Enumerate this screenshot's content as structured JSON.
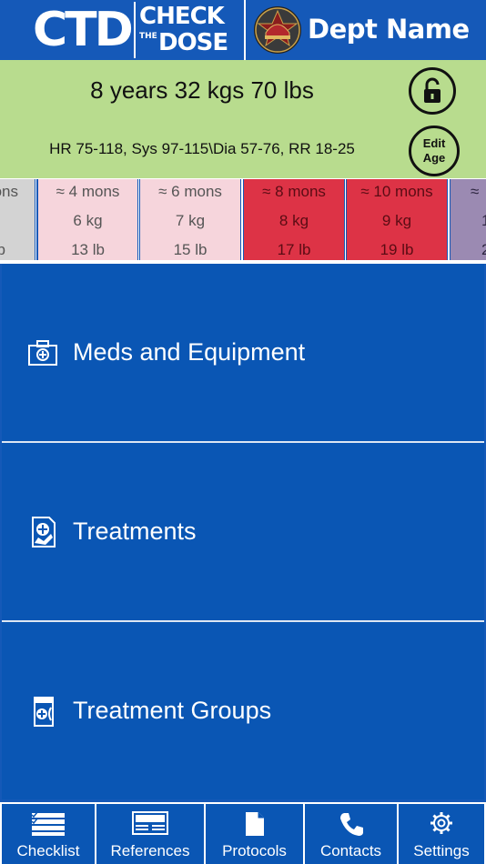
{
  "header": {
    "logo_ctd": "CTD",
    "logo_check": "CHECK",
    "logo_the": "THE",
    "logo_dose": "DOSE",
    "dept_name": "Dept Name",
    "dept_logo_icon": "fire-dept-badge-icon"
  },
  "patient": {
    "weight_line": "8 years 32 kgs 70 lbs",
    "vitals_line": "HR 75-118, Sys 97-115\\Dia 57-76, RR 18-25",
    "edit_label_1": "Edit",
    "edit_label_2": "Age",
    "lock_icon": "unlock-icon",
    "background_color": "#b8dc8e"
  },
  "age_strip": {
    "cells": [
      {
        "age": "ons",
        "kg": "",
        "lb": "b",
        "color": "#d3d3d3",
        "text_color": "#555555"
      },
      {
        "age": "≈ 4 mons",
        "kg": "6 kg",
        "lb": "13 lb",
        "color": "#f6d5dc",
        "text_color": "#555555"
      },
      {
        "age": "≈ 6 mons",
        "kg": "7 kg",
        "lb": "15 lb",
        "color": "#f6d5dc",
        "text_color": "#555555"
      },
      {
        "age": "≈ 8 mons",
        "kg": "8 kg",
        "lb": "17 lb",
        "color": "#dd3346",
        "text_color": "#5a0c14"
      },
      {
        "age": "≈ 10 mons",
        "kg": "9 kg",
        "lb": "19 lb",
        "color": "#dd3346",
        "text_color": "#5a0c14"
      },
      {
        "age": "≈",
        "kg": "1",
        "lb": "2",
        "color": "#9b8ab2",
        "text_color": "#2d2540"
      }
    ]
  },
  "menu": {
    "items": [
      {
        "label": "Meds and Equipment",
        "icon": "medical-kit-icon"
      },
      {
        "label": "Treatments",
        "icon": "medical-document-icon"
      },
      {
        "label": "Treatment Groups",
        "icon": "pill-bottles-icon"
      }
    ]
  },
  "bottom_nav": {
    "items": [
      {
        "label": "Checklist",
        "icon": "checklist-icon"
      },
      {
        "label": "References",
        "icon": "reference-card-icon"
      },
      {
        "label": "Protocols",
        "icon": "document-icon"
      },
      {
        "label": "Contacts",
        "icon": "phone-icon"
      },
      {
        "label": "Settings",
        "icon": "gear-icon"
      }
    ]
  },
  "colors": {
    "brand_blue": "#1559b8",
    "menu_blue": "#0a56b4",
    "danger_red": "#dd3346"
  }
}
